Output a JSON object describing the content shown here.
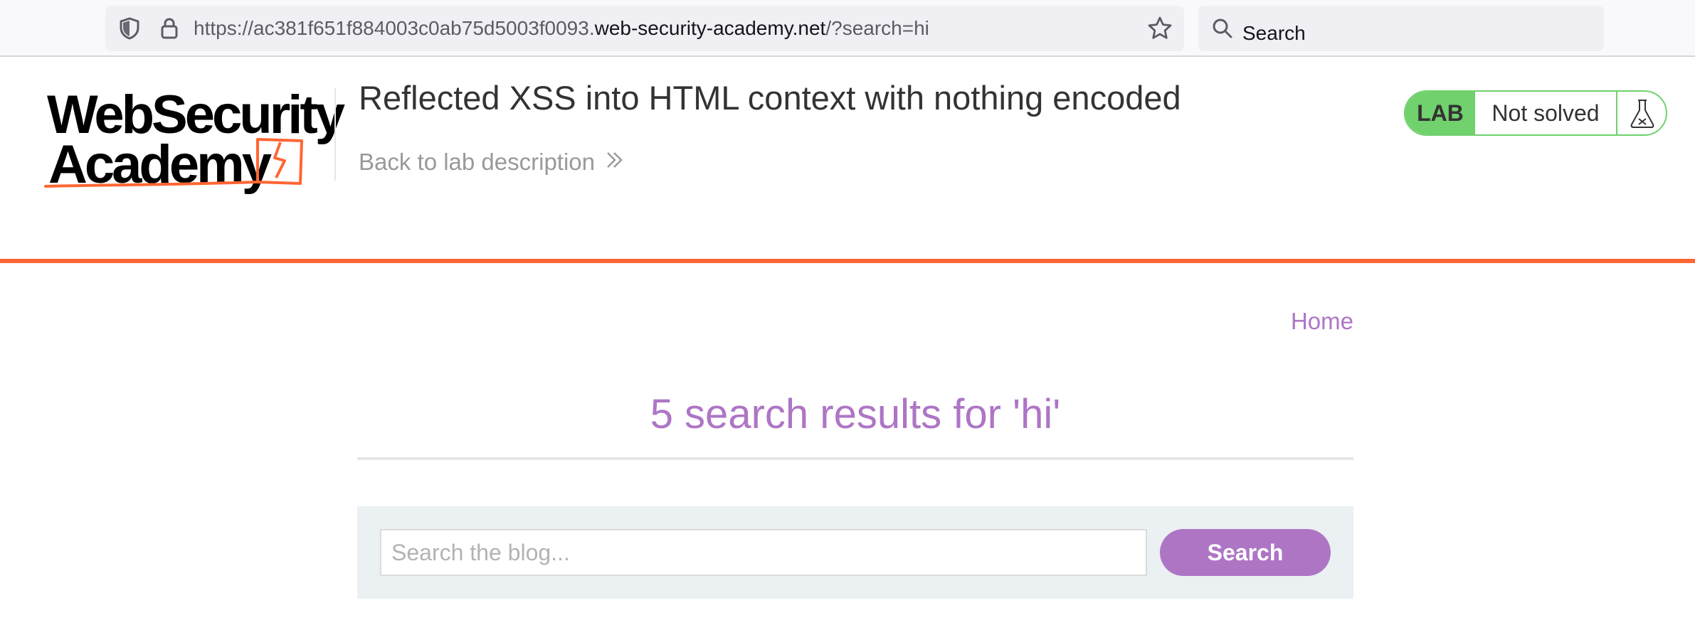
{
  "browser": {
    "url_prefix": "https://ac381f651f884003c0ab75d5003f0093.",
    "url_host": "web-security-academy.net",
    "url_suffix": "/?search=hi",
    "search_label": "Search",
    "icons": [
      "shield-icon",
      "lock-icon",
      "star-icon",
      "search-icon"
    ]
  },
  "header": {
    "logo_line1": "WebSecurity",
    "logo_line2": "Academy",
    "lab_title": "Reflected XSS into HTML context with nothing encoded",
    "back_link": "Back to lab description",
    "status_badge": "LAB",
    "status_text": "Not solved"
  },
  "nav": {
    "home": "Home"
  },
  "results": {
    "heading": "5 search results for 'hi'"
  },
  "search": {
    "placeholder": "Search the blog...",
    "value": "",
    "button_label": "Search"
  },
  "colors": {
    "accent": "#ae75c5",
    "brand_orange": "#ff6633",
    "lab_green": "#70d16d",
    "panel_bg": "#ebf0f2"
  }
}
